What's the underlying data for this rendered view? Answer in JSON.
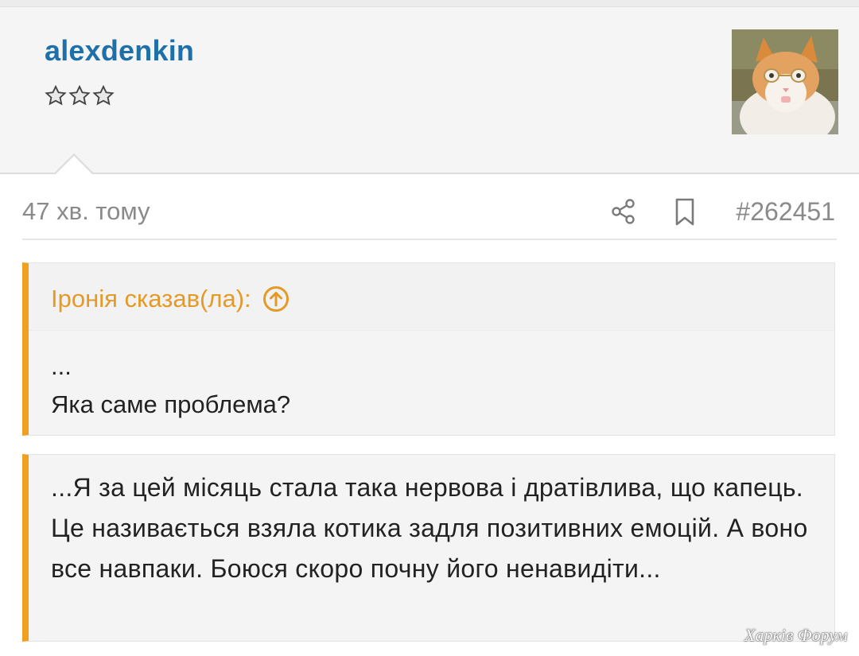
{
  "post": {
    "username": "alexdenkin",
    "rank_stars": 3,
    "time_ago": "47 хв. тому",
    "post_number": "#262451",
    "share_icon": "share-icon",
    "bookmark_icon": "bookmark-icon"
  },
  "quote": {
    "author_label": "Іронія сказав(ла):",
    "jump_icon": "arrow-up-circle-icon",
    "lines": [
      "...",
      "Яка саме проблема?"
    ]
  },
  "message": {
    "text": "...Я за цей місяць стала така нервова і дратівлива, що капець. Це називається взяла котика задля позитивних емоцій. А воно все навпаки. Боюся скоро почну його ненавидіти..."
  },
  "watermark": "Харків Форум",
  "colors": {
    "username": "#1f6fa8",
    "quote_accent": "#f0a020",
    "quote_author": "#e49a27",
    "meta_text": "#8a8a8a"
  }
}
